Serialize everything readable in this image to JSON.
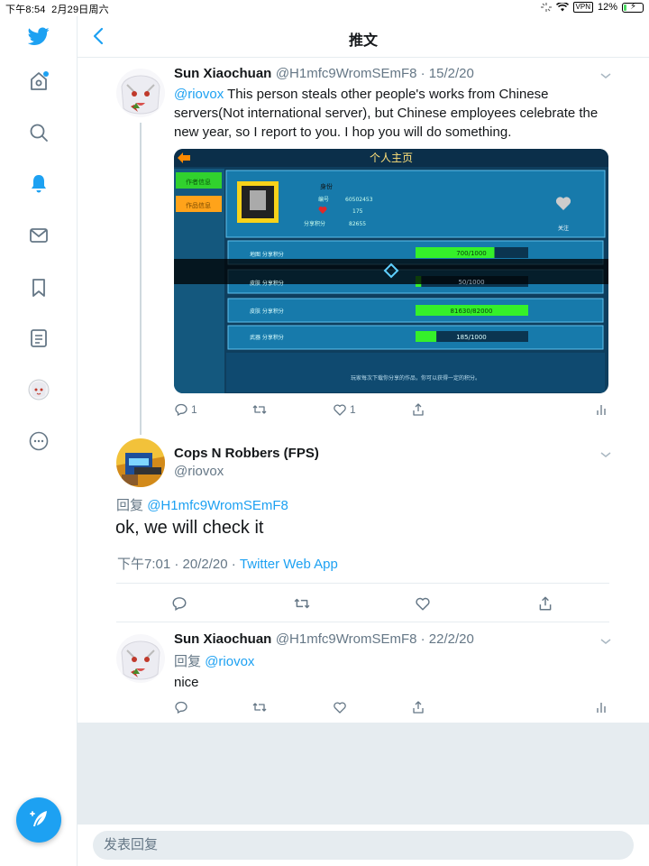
{
  "status_bar": {
    "time": "下午8:54",
    "date": "2月29日周六",
    "vpn": "VPN",
    "battery": "12%"
  },
  "colors": {
    "accent": "#1da1f2",
    "border": "#e6ecf0",
    "muted": "#657786"
  },
  "sidebar": {
    "items": [
      {
        "icon": "twitter-logo-icon"
      },
      {
        "icon": "home-icon"
      },
      {
        "icon": "search-icon"
      },
      {
        "icon": "notifications-icon"
      },
      {
        "icon": "messages-icon"
      },
      {
        "icon": "bookmarks-icon"
      },
      {
        "icon": "lists-icon"
      },
      {
        "icon": "profile-avatar-icon"
      },
      {
        "icon": "more-icon"
      }
    ],
    "compose_icon": "compose-tweet-icon"
  },
  "header": {
    "title": "推文"
  },
  "tweets": [
    {
      "name": "Sun Xiaochuan",
      "handle": "@H1mfc9WromSEmF8 · 15/2/20",
      "mention": "@riovox",
      "text": " This person steals other people's works from Chinese servers(Not international server), but Chinese employees celebrate the new year, so I report to you.   I hop you will do something.",
      "reply_count": "1",
      "like_count": "1"
    }
  ],
  "game_screenshot": {
    "title": "个人主页",
    "tab1": "作者信息",
    "tab2": "作品信息",
    "profile_label": "身份",
    "id_label": "编号",
    "id_value": "60502453",
    "hearts_value": "175",
    "share_label": "分享积分",
    "share_value": "82655",
    "follow_label": "关注",
    "rows": [
      {
        "label": "地图 分享积分",
        "value": "700/1000",
        "fill": 0.7
      },
      {
        "label": "皮肤 分享积分",
        "value": "50/1000",
        "fill": 0.05
      },
      {
        "label": "皮肤 分享积分",
        "value": "81630/82000",
        "fill": 1.0
      },
      {
        "label": "武器 分享积分",
        "value": "185/1000",
        "fill": 0.185
      }
    ],
    "footer": "玩家每次下载你分享的作品，你可以获得一定的积分。"
  },
  "main_tweet": {
    "name": "Cops N Robbers (FPS)",
    "handle": "@riovox",
    "reply_prefix": "回复",
    "reply_to": "@H1mfc9WromSEmF8",
    "text": "ok, we will check it",
    "time": "下午7:01 · 20/2/20 · ",
    "source": "Twitter Web App"
  },
  "reply_tweet": {
    "name": "Sun Xiaochuan",
    "handle": "@H1mfc9WromSEmF8 · 22/2/20",
    "reply_prefix": "回复",
    "reply_to": "@riovox",
    "text": "nice"
  },
  "reply_bar": {
    "placeholder": "发表回复"
  }
}
